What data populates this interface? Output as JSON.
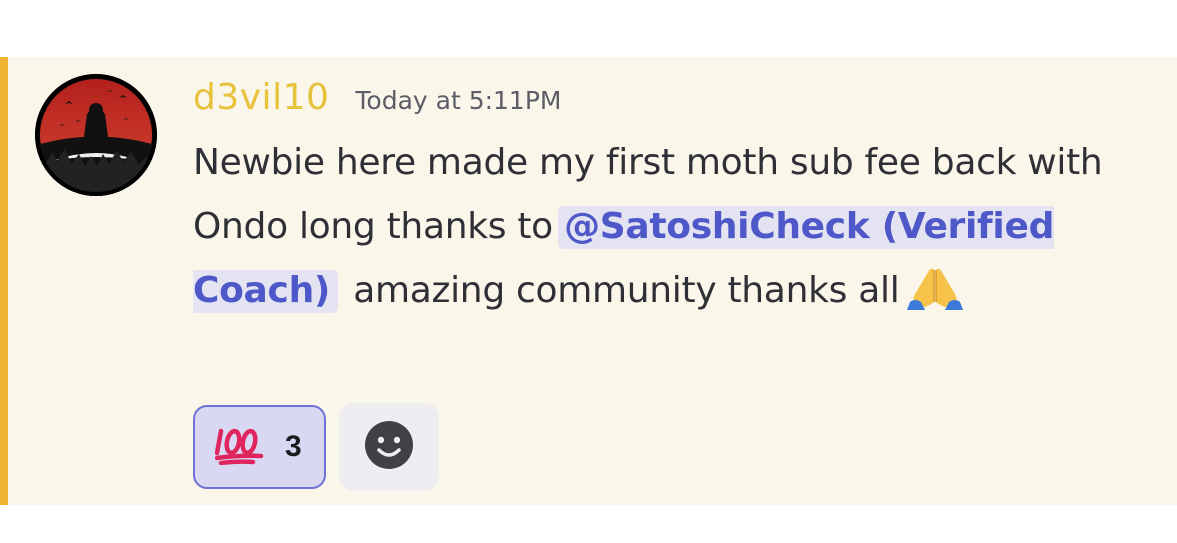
{
  "message": {
    "username": "d3vil10",
    "timestamp": "Today at 5:11PM",
    "text_before_mention": "Newbie here made my first moth sub fee back with Ondo long thanks to ",
    "mention": "@SatoshiCheck (Verified Coach)",
    "text_after_mention": " amazing community thanks all",
    "emoji": "pray-icon",
    "username_color": "#e6c23d",
    "highlight_color": "#f0b232",
    "mention_color": "#4e58c8"
  },
  "reactions": [
    {
      "emoji": "hundred-points-icon",
      "count": "3",
      "selected": true
    }
  ],
  "add_reaction": {
    "icon": "smiley-icon"
  }
}
